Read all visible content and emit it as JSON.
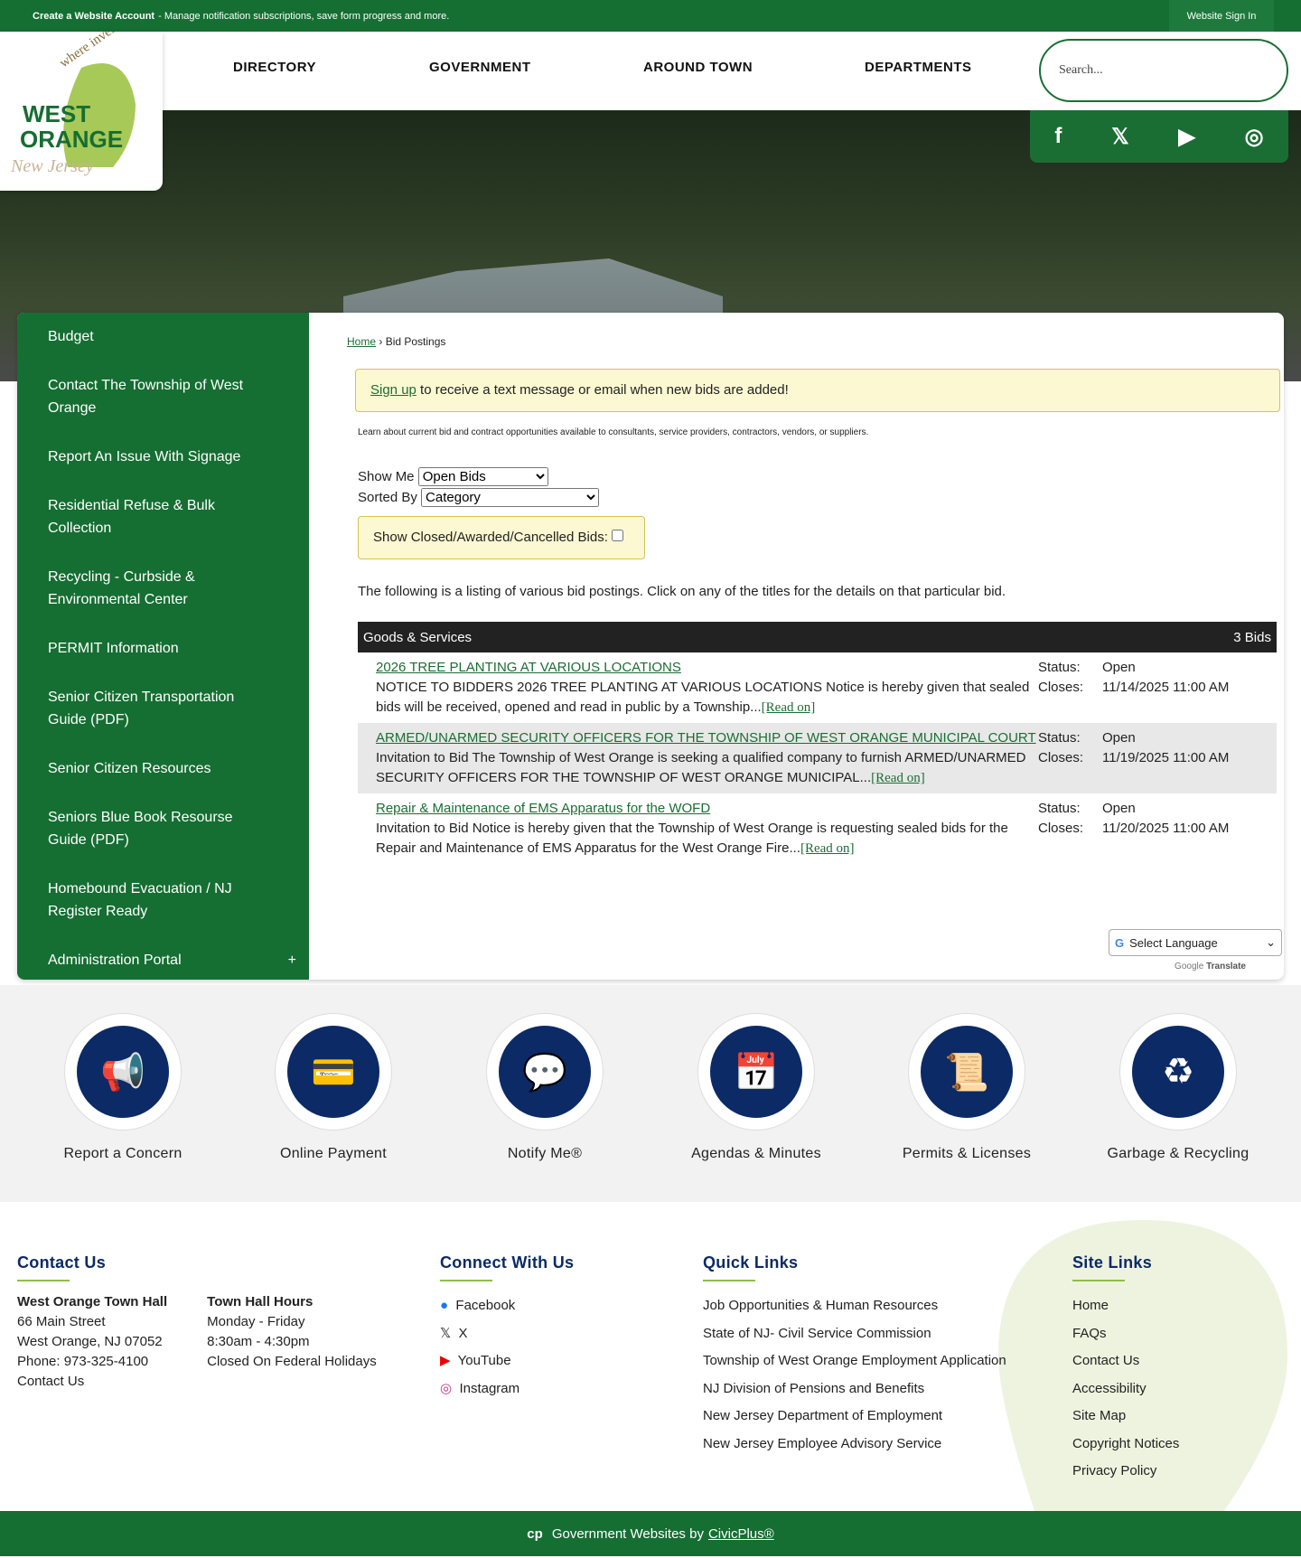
{
  "topbar": {
    "account_bold": "Create a Website Account",
    "account_text": " - Manage notification subscriptions, save form progress and more.",
    "signin": "Website Sign In"
  },
  "logo": {
    "text": "WEST ORANGE",
    "tagline": "where invention lives",
    "state": "New Jersey"
  },
  "nav": [
    "DIRECTORY",
    "GOVERNMENT",
    "AROUND TOWN",
    "DEPARTMENTS"
  ],
  "search": {
    "placeholder": "Search..."
  },
  "social": [
    "facebook",
    "x",
    "youtube",
    "instagram"
  ],
  "sidebar": [
    "Budget",
    "Contact The Township of West Orange",
    "Report An Issue With Signage",
    "Residential Refuse & Bulk Collection",
    "Recycling - Curbside & Environmental Center",
    "PERMIT Information",
    "Senior Citizen Transportation Guide (PDF)",
    "Senior Citizen Resources",
    "Seniors Blue Book Resourse Guide (PDF)",
    "Homebound Evacuation / NJ Register Ready",
    "Administration Portal"
  ],
  "breadcrumb": {
    "home": "Home",
    "sep": " › ",
    "current": "Bid Postings"
  },
  "notice": {
    "link": "Sign up",
    "text": " to receive a text message or email when new bids are added!"
  },
  "learn": "Learn about current bid and contract opportunities available to consultants, service providers, contractors, vendors, or suppliers.",
  "filters": {
    "show_label": "Show Me",
    "show_value": "Open Bids",
    "sort_label": "Sorted By",
    "sort_value": "Category",
    "closed_label": "Show Closed/Awarded/Cancelled Bids:"
  },
  "listing_text": "The following is a listing of various bid postings. Click on any of the titles for the details on that particular bid.",
  "table": {
    "category": "Goods & Services",
    "count": "3 Bids",
    "status_label": "Status:",
    "closes_label": "Closes:",
    "read_on": "[Read on]",
    "bids": [
      {
        "title": "2026 TREE PLANTING AT VARIOUS LOCATIONS",
        "desc": "NOTICE TO BIDDERS 2026 TREE PLANTING AT VARIOUS LOCATIONS Notice is hereby given that sealed bids will be received, opened and read in public by a Township...",
        "status": "Open",
        "closes": "11/14/2025 11:00 AM"
      },
      {
        "title": "ARMED/UNARMED SECURITY OFFICERS FOR THE TOWNSHIP OF WEST ORANGE MUNICIPAL COURT",
        "desc": "Invitation to Bid The Township of West Orange is seeking a qualified company to furnish ARMED/UNARMED SECURITY OFFICERS FOR THE TOWNSHIP OF WEST ORANGE MUNICIPAL...",
        "status": "Open",
        "closes": "11/19/2025 11:00 AM"
      },
      {
        "title": "Repair & Maintenance of EMS Apparatus for the WOFD",
        "desc": "Invitation to Bid Notice is hereby given that the Township of West Orange is requesting sealed bids for the Repair and Maintenance of EMS Apparatus for the West Orange Fire...",
        "status": "Open",
        "closes": "11/20/2025 11:00 AM"
      }
    ]
  },
  "translate": {
    "select": "Select Language",
    "powered": "Google",
    "translate": "Translate"
  },
  "quick": [
    {
      "label": "Report a Concern",
      "icon": "📢"
    },
    {
      "label": "Online Payment",
      "icon": "💳"
    },
    {
      "label": "Notify Me®",
      "icon": "💬"
    },
    {
      "label": "Agendas & Minutes",
      "icon": "📅"
    },
    {
      "label": "Permits & Licenses",
      "icon": "📜"
    },
    {
      "label": "Garbage & Recycling",
      "icon": "♻"
    }
  ],
  "footer": {
    "contact": {
      "title": "Contact Us",
      "hall": "West Orange Town Hall",
      "addr1": "66 Main Street",
      "addr2": "West Orange, NJ 07052",
      "phone": "Phone: 973-325-4100",
      "link": "Contact Us",
      "hours_title": "Town Hall Hours",
      "days": "Monday - Friday",
      "hours": "8:30am - 4:30pm",
      "closed": "Closed On Federal Holidays"
    },
    "connect": {
      "title": "Connect With Us",
      "items": [
        "Facebook",
        "X",
        "YouTube",
        "Instagram"
      ]
    },
    "quick": {
      "title": "Quick Links",
      "items": [
        "Job Opportunities & Human Resources",
        "State of NJ- Civil Service Commission",
        "Township of West Orange Employment Application",
        "NJ Division of Pensions and Benefits",
        "New Jersey Department of Employment",
        "New Jersey Employee Advisory Service"
      ]
    },
    "site": {
      "title": "Site Links",
      "items": [
        "Home",
        "FAQs",
        "Contact Us",
        "Accessibility",
        "Site Map",
        "Copyright Notices",
        "Privacy Policy"
      ]
    }
  },
  "bottom": {
    "text": "Government Websites by",
    "link": "CivicPlus®"
  }
}
